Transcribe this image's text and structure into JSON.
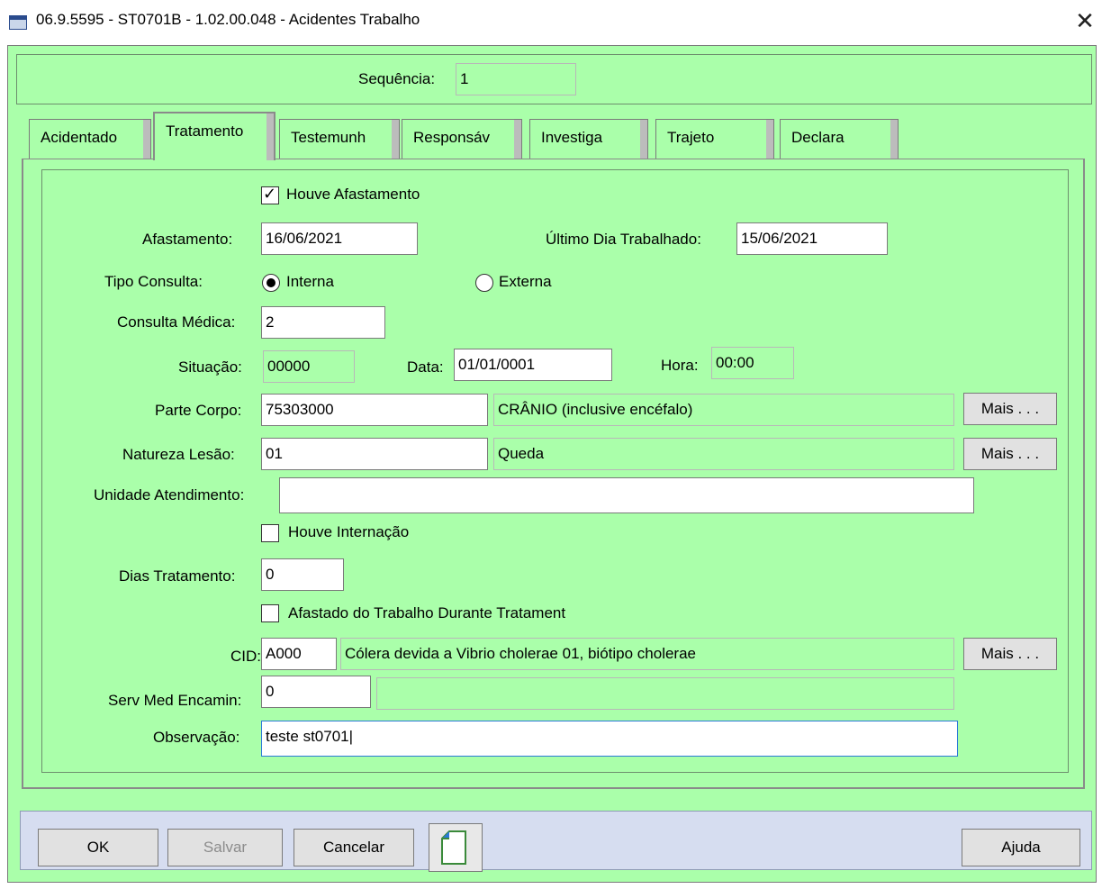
{
  "window": {
    "title": "06.9.5595 - ST0701B - 1.02.00.048 - Acidentes Trabalho",
    "close_symbol": "✕"
  },
  "sequence": {
    "label": "Sequência:",
    "value": "1"
  },
  "tabs": [
    {
      "label": "Acidentado"
    },
    {
      "label": "Tratamento"
    },
    {
      "label": "Testemunh"
    },
    {
      "label": "Responsáv"
    },
    {
      "label": "Investiga"
    },
    {
      "label": "Trajeto"
    },
    {
      "label": "Declara"
    }
  ],
  "form": {
    "houve_afastamento": {
      "label": "Houve Afastamento",
      "checked": true
    },
    "afastamento": {
      "label": "Afastamento:",
      "value": "16/06/2021"
    },
    "ultimo_dia": {
      "label": "Último Dia Trabalhado:",
      "value": "15/06/2021"
    },
    "tipo_consulta": {
      "label": "Tipo Consulta:",
      "option_interna": "Interna",
      "option_externa": "Externa",
      "selected": "Interna"
    },
    "consulta_medica": {
      "label": "Consulta Médica:",
      "value": "2"
    },
    "situacao": {
      "label": "Situação:",
      "value": "00000"
    },
    "data": {
      "label": "Data:",
      "value": "01/01/0001"
    },
    "hora": {
      "label": "Hora:",
      "value": "00:00"
    },
    "parte_corpo": {
      "label": "Parte Corpo:",
      "code": "75303000",
      "description": "CRÂNIO (inclusive encéfalo)",
      "button": "Mais . . ."
    },
    "natureza_lesao": {
      "label": "Natureza Lesão:",
      "code": "01",
      "description": "Queda",
      "button": "Mais . . ."
    },
    "unidade_atendimento": {
      "label": "Unidade Atendimento:",
      "value": ""
    },
    "houve_internacao": {
      "label": "Houve Internação",
      "checked": false
    },
    "dias_tratamento": {
      "label": "Dias Tratamento:",
      "value": "0"
    },
    "afastado_trabalho": {
      "label": "Afastado do Trabalho Durante Tratament",
      "checked": false
    },
    "cid": {
      "label": "CID:",
      "code": "A000",
      "description": "Cólera devida a Vibrio cholerae 01, biótipo cholerae",
      "button": "Mais . . ."
    },
    "serv_med": {
      "label": "Serv Med Encamin:",
      "code": "0",
      "description": ""
    },
    "observacao": {
      "label": "Observação:",
      "value": "teste st0701|"
    }
  },
  "buttons": {
    "ok": "OK",
    "salvar": "Salvar",
    "cancelar": "Cancelar",
    "ajuda": "Ajuda"
  },
  "icons": {
    "app": "window-app-icon",
    "doc": "document-icon"
  },
  "colors": {
    "client_bg": "#aaffaa",
    "bottom_bar": "#d6ddf0",
    "focus_border": "#2b79d7"
  }
}
